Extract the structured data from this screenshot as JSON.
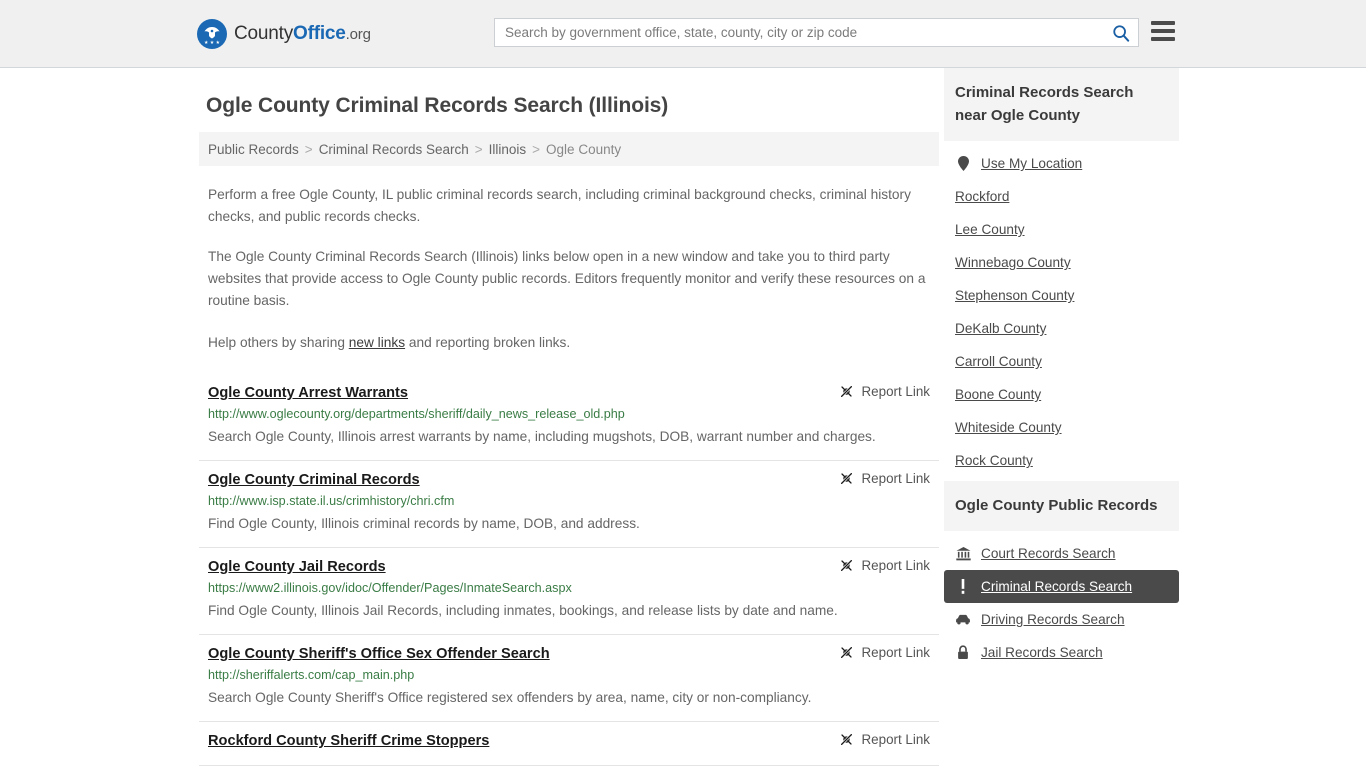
{
  "header": {
    "logo": {
      "icon": "eagle-shield-logo-icon",
      "text_1": "County",
      "text_2": "Office",
      "text_3": ".org"
    },
    "search": {
      "placeholder": "Search by government office, state, county, city or zip code",
      "value": "",
      "search_icon": "search-icon"
    },
    "menu_icon": "hamburger-menu-icon"
  },
  "page_title": "Ogle County Criminal Records Search (Illinois)",
  "breadcrumb": {
    "items": [
      {
        "label": "Public Records",
        "current": false
      },
      {
        "label": "Criminal Records Search",
        "current": false
      },
      {
        "label": "Illinois",
        "current": false
      },
      {
        "label": "Ogle County",
        "current": true
      }
    ],
    "separator": ">"
  },
  "intro": {
    "p1": "Perform a free Ogle County, IL public criminal records search, including criminal background checks, criminal history checks, and public records checks.",
    "p2": "The Ogle County Criminal Records Search (Illinois) links below open in a new window and take you to third party websites that provide access to Ogle County public records. Editors frequently monitor and verify these resources on a routine basis.",
    "p3_before": "Help others by sharing ",
    "p3_link": "new links",
    "p3_after": " and reporting broken links."
  },
  "report_link": {
    "label": "Report Link",
    "icon": "broken-link-icon"
  },
  "links": [
    {
      "title": "Ogle County Arrest Warrants",
      "url": "http://www.oglecounty.org/departments/sheriff/daily_news_release_old.php",
      "description": "Search Ogle County, Illinois arrest warrants by name, including mugshots, DOB, warrant number and charges."
    },
    {
      "title": "Ogle County Criminal Records",
      "url": "http://www.isp.state.il.us/crimhistory/chri.cfm",
      "description": "Find Ogle County, Illinois criminal records by name, DOB, and address."
    },
    {
      "title": "Ogle County Jail Records",
      "url": "https://www2.illinois.gov/idoc/Offender/Pages/InmateSearch.aspx",
      "description": "Find Ogle County, Illinois Jail Records, including inmates, bookings, and release lists by date and name."
    },
    {
      "title": "Ogle County Sheriff's Office Sex Offender Search",
      "url": "http://sheriffalerts.com/cap_main.php",
      "description": "Search Ogle County Sheriff's Office registered sex offenders by area, name, city or non-compliancy."
    },
    {
      "title": "Rockford County Sheriff Crime Stoppers",
      "url": "",
      "description": ""
    }
  ],
  "sidebar": {
    "nearby": {
      "heading": "Criminal Records Search near Ogle County",
      "items": [
        {
          "label": "Use My Location",
          "icon": "map-pin-icon",
          "active": false
        },
        {
          "label": "Rockford",
          "icon": "",
          "active": false
        },
        {
          "label": "Lee County",
          "icon": "",
          "active": false
        },
        {
          "label": "Winnebago County",
          "icon": "",
          "active": false
        },
        {
          "label": "Stephenson County",
          "icon": "",
          "active": false
        },
        {
          "label": "DeKalb County",
          "icon": "",
          "active": false
        },
        {
          "label": "Carroll County",
          "icon": "",
          "active": false
        },
        {
          "label": "Boone County",
          "icon": "",
          "active": false
        },
        {
          "label": "Whiteside County",
          "icon": "",
          "active": false
        },
        {
          "label": "Rock County",
          "icon": "",
          "active": false
        }
      ]
    },
    "public_records": {
      "heading": "Ogle County Public Records",
      "items": [
        {
          "label": "Court Records Search",
          "icon": "courthouse-icon",
          "active": false
        },
        {
          "label": "Criminal Records Search",
          "icon": "exclamation-icon",
          "active": true
        },
        {
          "label": "Driving Records Search",
          "icon": "car-icon",
          "active": false
        },
        {
          "label": "Jail Records Search",
          "icon": "lock-icon",
          "active": false
        }
      ]
    }
  },
  "colors": {
    "brand_blue": "#1b69b4",
    "url_green": "#3a7c45",
    "active_bg": "#4a4a4a",
    "header_bg": "#f0f0f0",
    "panel_bg": "#f4f4f4"
  }
}
